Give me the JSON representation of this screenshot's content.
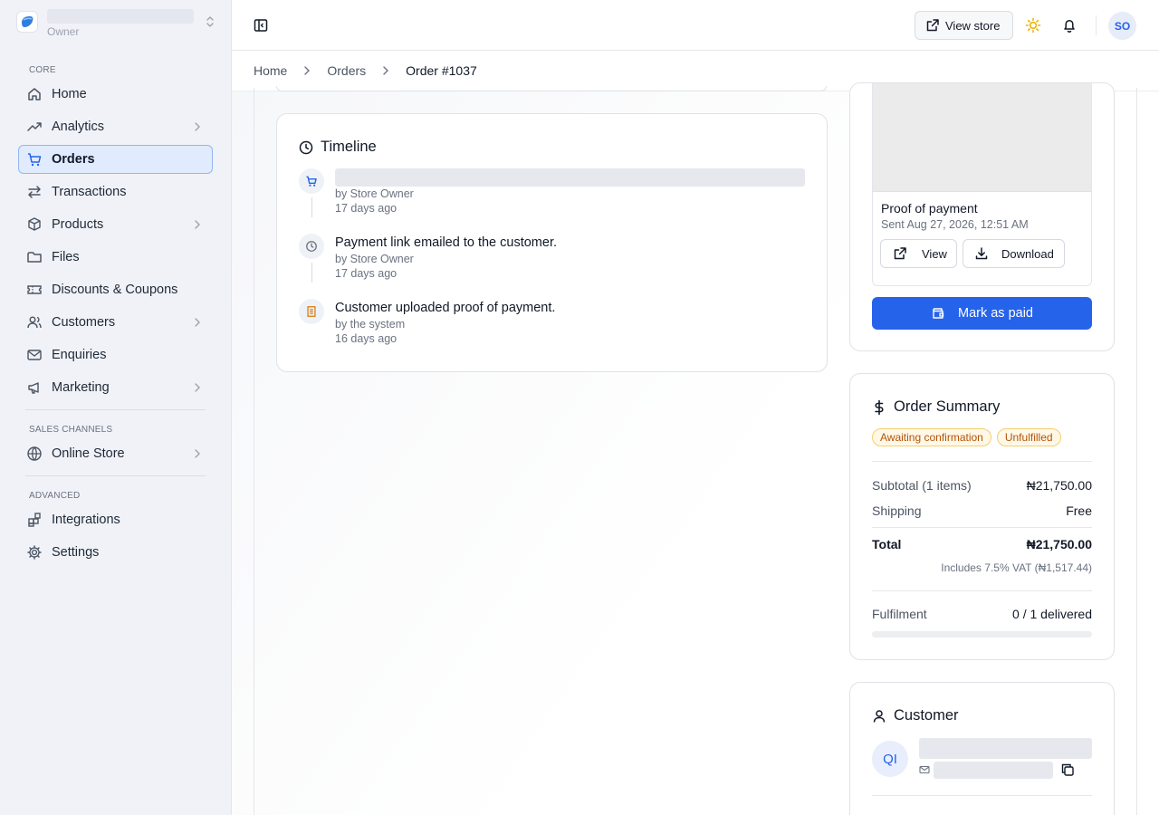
{
  "store": {
    "role": "Owner"
  },
  "sidebar": {
    "sections": [
      {
        "label": "CORE"
      },
      {
        "label": "SALES CHANNELS"
      },
      {
        "label": "ADVANCED"
      }
    ],
    "items": [
      {
        "label": "Home",
        "icon": "home-icon"
      },
      {
        "label": "Analytics",
        "icon": "trending-up-icon",
        "expandable": true
      },
      {
        "label": "Orders",
        "icon": "cart-icon",
        "active": true
      },
      {
        "label": "Transactions",
        "icon": "arrows-left-right-icon"
      },
      {
        "label": "Products",
        "icon": "box-icon",
        "expandable": true
      },
      {
        "label": "Files",
        "icon": "folder-icon"
      },
      {
        "label": "Discounts & Coupons",
        "icon": "ticket-icon"
      },
      {
        "label": "Customers",
        "icon": "users-icon",
        "expandable": true
      },
      {
        "label": "Enquiries",
        "icon": "mail-icon"
      },
      {
        "label": "Marketing",
        "icon": "megaphone-icon",
        "expandable": true
      },
      {
        "label": "Online Store",
        "icon": "globe-icon",
        "expandable": true
      },
      {
        "label": "Integrations",
        "icon": "blocks-icon"
      },
      {
        "label": "Settings",
        "icon": "gear-icon"
      }
    ]
  },
  "topbar": {
    "view_store": "View store",
    "avatar_initials": "SO"
  },
  "breadcrumb": [
    "Home",
    "Orders",
    "Order #1037"
  ],
  "timeline": {
    "title": "Timeline",
    "events": [
      {
        "title": "",
        "by": "by Store Owner",
        "when": "17 days ago",
        "icon": "cart-icon"
      },
      {
        "title": "Payment link emailed to the customer.",
        "by": "by Store Owner",
        "when": "17 days ago",
        "icon": "clock-icon"
      },
      {
        "title": "Customer uploaded proof of payment.",
        "by": "by the system",
        "when": "16 days ago",
        "icon": "receipt-icon"
      }
    ]
  },
  "proof": {
    "label": "Proof of payment",
    "sent": "Sent Aug 27, 2026, 12:51 AM",
    "view_label": "View",
    "download_label": "Download",
    "mark_paid_label": "Mark as paid"
  },
  "summary": {
    "title": "Order Summary",
    "badges": [
      "Awaiting confirmation",
      "Unfulfilled"
    ],
    "subtotal_label": "Subtotal (1 items)",
    "subtotal_value": "₦21,750.00",
    "shipping_label": "Shipping",
    "shipping_value": "Free",
    "total_label": "Total",
    "total_value": "₦21,750.00",
    "vat_note": "Includes 7.5% VAT (₦1,517.44)",
    "fulfilment_label": "Fulfilment",
    "fulfilment_value": "0 / 1 delivered",
    "fulfilment_progress": 0
  },
  "customer": {
    "title": "Customer",
    "initials": "QI"
  },
  "colors": {
    "accent": "#2563eb",
    "active_nav_bg": "#e0ebfd",
    "badge_text": "#b45309",
    "badge_bg": "#fff8e6"
  }
}
